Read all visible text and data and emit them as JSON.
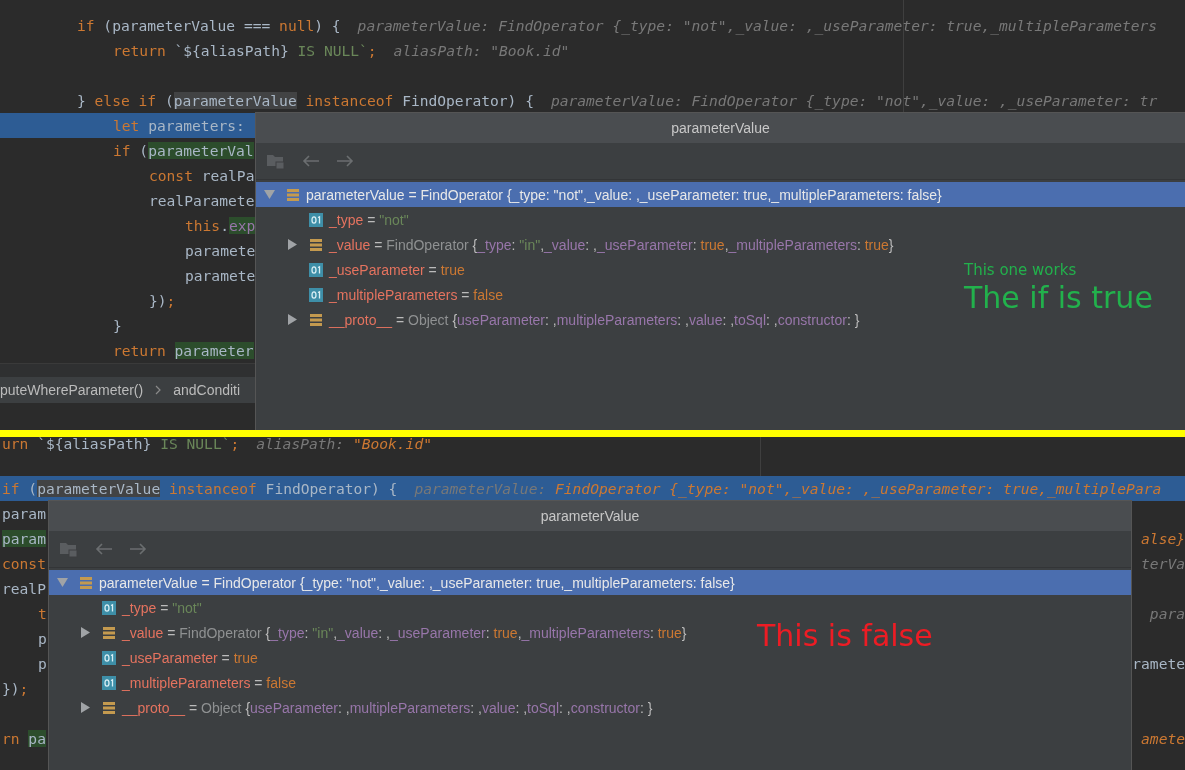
{
  "panels": [
    {
      "editor": {
        "lines": [
          {
            "kind": "code",
            "selected": false,
            "code": [
              {
                "text": "if",
                "kind": "kw"
              },
              {
                "text": " (parameterValue === ",
                "kind": "id"
              },
              {
                "text": "null",
                "kind": "kw"
              },
              {
                "text": ") {",
                "kind": "id"
              }
            ],
            "hint": [
              {
                "text": "parameterValue: FindOperator {_type: \"not\",_value: ,_useParameter: true,_multipleParameters",
                "kind": "hint"
              }
            ],
            "children": [
              {
                "kind": "code",
                "selected": false,
                "code": [
                  {
                    "text": "return",
                    "kind": "kw"
                  },
                  {
                    "text": " `${aliasPath}",
                    "kind": "id"
                  },
                  {
                    "text": " IS NULL`",
                    "kind": "str"
                  },
                  {
                    "text": ";",
                    "kind": "kw"
                  }
                ],
                "hint": [
                  {
                    "text": "aliasPath: \"Book.id\"",
                    "kind": "hint"
                  }
                ]
              },
              {
                "kind": "blank",
                "selected": false
              }
            ]
          },
          {
            "kind": "code",
            "selected": false,
            "code": [
              {
                "text": "} ",
                "kind": "id"
              },
              {
                "text": "else if ",
                "kind": "kw"
              },
              {
                "text": "(",
                "kind": "id"
              },
              {
                "text": "parameterValue",
                "kind": "id",
                "read_highlight": true
              },
              {
                "text": " instanceof",
                "kind": "kw"
              },
              {
                "text": " FindOperator) {",
                "kind": "id"
              }
            ],
            "hint": [
              {
                "text": "parameterValue: FindOperator {_type: \"not\",_value: ,_useParameter: tr",
                "kind": "hint"
              }
            ],
            "children": [
              {
                "kind": "code",
                "selected": true,
                "code": [
                  {
                    "text": "let",
                    "kind": "kw"
                  },
                  {
                    "text": " parameters:",
                    "kind": "id"
                  }
                ]
              },
              {
                "kind": "code",
                "selected": false,
                "code": [
                  {
                    "text": "if",
                    "kind": "kw"
                  },
                  {
                    "text": " (",
                    "kind": "id"
                  },
                  {
                    "text": "parameterVal",
                    "kind": "id",
                    "write_highlight": true
                  }
                ],
                "children": [
                  {
                    "kind": "code",
                    "selected": false,
                    "code": [
                      {
                        "text": "const",
                        "kind": "kw"
                      },
                      {
                        "text": " realPa",
                        "kind": "id"
                      }
                    ]
                  },
                  {
                    "kind": "code",
                    "selected": false,
                    "code": [
                      {
                        "text": "realParamete",
                        "kind": "id"
                      }
                    ],
                    "children": [
                      {
                        "kind": "code",
                        "selected": false,
                        "code": [
                          {
                            "text": "this",
                            "kind": "kw"
                          },
                          {
                            "text": ".",
                            "kind": "id"
                          },
                          {
                            "text": "exp",
                            "kind": "prop",
                            "write_highlight": true
                          }
                        ]
                      },
                      {
                        "kind": "code",
                        "selected": false,
                        "code": [
                          {
                            "text": "paramete",
                            "kind": "id"
                          }
                        ]
                      },
                      {
                        "kind": "code",
                        "selected": false,
                        "code": [
                          {
                            "text": "paramete",
                            "kind": "id"
                          }
                        ]
                      }
                    ]
                  },
                  {
                    "kind": "code",
                    "selected": false,
                    "code": [
                      {
                        "text": "})",
                        "kind": "id"
                      },
                      {
                        "text": ";",
                        "kind": "kw"
                      }
                    ]
                  }
                ]
              },
              {
                "kind": "code",
                "selected": false,
                "code": [
                  {
                    "text": "}",
                    "kind": "id"
                  }
                ]
              },
              {
                "kind": "code",
                "selected": false,
                "code": [
                  {
                    "text": "return ",
                    "kind": "kw"
                  },
                  {
                    "text": "parameter",
                    "kind": "id",
                    "write_highlight": true
                  }
                ]
              }
            ]
          }
        ]
      },
      "breadcrumbs": [
        {
          "text": "puteWhereParameter()"
        },
        {
          "text": "andConditi"
        }
      ],
      "popup": {
        "title": "parameterValue",
        "tree": [
          {
            "name": "parameterValue",
            "operator": "=",
            "kind": "object",
            "expanded": true,
            "selected": true,
            "value": [
              {
                "text": "FindOperator {_type: \"not\",_value: ,_useParameter: true,_multipleParameters: false}",
                "kind": "plain"
              }
            ],
            "children": [
              {
                "name": "_type",
                "operator": "=",
                "kind": "primitive",
                "selected": false,
                "value": [
                  {
                    "text": "\"not\"",
                    "kind": "string"
                  }
                ]
              },
              {
                "name": "_value",
                "operator": "=",
                "kind": "object",
                "expanded": false,
                "selected": false,
                "value": [
                  {
                    "text": "FindOperator ",
                    "kind": "type"
                  },
                  {
                    "text": "{",
                    "kind": "plain"
                  },
                  {
                    "text": "_type",
                    "kind": "prop"
                  },
                  {
                    "text": ": ",
                    "kind": "plain"
                  },
                  {
                    "text": "\"in\"",
                    "kind": "string"
                  },
                  {
                    "text": ",",
                    "kind": "plain"
                  },
                  {
                    "text": "_value",
                    "kind": "prop"
                  },
                  {
                    "text": ": ,",
                    "kind": "plain"
                  },
                  {
                    "text": "_useParameter",
                    "kind": "prop"
                  },
                  {
                    "text": ": ",
                    "kind": "plain"
                  },
                  {
                    "text": "true",
                    "kind": "keyword"
                  },
                  {
                    "text": ",",
                    "kind": "plain"
                  },
                  {
                    "text": "_multipleParameters",
                    "kind": "prop"
                  },
                  {
                    "text": ": ",
                    "kind": "plain"
                  },
                  {
                    "text": "true",
                    "kind": "keyword"
                  },
                  {
                    "text": "}",
                    "kind": "plain"
                  }
                ]
              },
              {
                "name": "_useParameter",
                "operator": "=",
                "kind": "primitive",
                "selected": false,
                "value": [
                  {
                    "text": "true",
                    "kind": "keyword"
                  }
                ]
              },
              {
                "name": "_multipleParameters",
                "operator": "=",
                "kind": "primitive",
                "selected": false,
                "value": [
                  {
                    "text": "false",
                    "kind": "keyword"
                  }
                ]
              },
              {
                "name": "__proto__",
                "operator": "=",
                "kind": "object",
                "expanded": false,
                "selected": false,
                "value": [
                  {
                    "text": "Object ",
                    "kind": "type"
                  },
                  {
                    "text": "{",
                    "kind": "plain"
                  },
                  {
                    "text": "useParameter",
                    "kind": "prop"
                  },
                  {
                    "text": ": ,",
                    "kind": "plain"
                  },
                  {
                    "text": "multipleParameters",
                    "kind": "prop"
                  },
                  {
                    "text": ": ,",
                    "kind": "plain"
                  },
                  {
                    "text": "value",
                    "kind": "prop"
                  },
                  {
                    "text": ": ,",
                    "kind": "plain"
                  },
                  {
                    "text": "toSql",
                    "kind": "prop"
                  },
                  {
                    "text": ": ,",
                    "kind": "plain"
                  },
                  {
                    "text": "constructor",
                    "kind": "prop"
                  },
                  {
                    "text": ": }",
                    "kind": "plain"
                  }
                ]
              }
            ]
          }
        ],
        "annotations": [
          {
            "text": "This one works",
            "kind": "caption",
            "color": "#22b14c"
          },
          {
            "text": "The if is true",
            "kind": "headline",
            "color": "#22b14c"
          }
        ]
      }
    },
    {
      "editor": {
        "lines": [
          {
            "kind": "code",
            "selected": false,
            "code": [
              {
                "text": "urn",
                "kind": "kw"
              },
              {
                "text": " `${aliasPath}",
                "kind": "id"
              },
              {
                "text": " IS NULL`",
                "kind": "str"
              },
              {
                "text": ";",
                "kind": "kw"
              }
            ],
            "hint": [
              {
                "text": "aliasPath: ",
                "kind": "hint"
              },
              {
                "text": "\"Book.id\"",
                "kind": "hintval"
              }
            ]
          },
          {
            "kind": "blank",
            "selected": false
          },
          {
            "kind": "code",
            "selected": true,
            "code": [
              {
                "text": "if",
                "kind": "kw"
              },
              {
                "text": " (",
                "kind": "id"
              },
              {
                "text": "parameterValue",
                "kind": "id",
                "read_highlight": true
              },
              {
                "text": " instanceof",
                "kind": "kw"
              },
              {
                "text": " FindOperator) {",
                "kind": "id"
              }
            ],
            "hint": [
              {
                "text": "parameterValue: ",
                "kind": "hint"
              },
              {
                "text": "FindOperator {_type: \"not\",_value: ,_useParameter: true,_multiplePara",
                "kind": "hintval"
              }
            ]
          },
          {
            "kind": "code",
            "selected": false,
            "code": [
              {
                "text": "param",
                "kind": "id"
              }
            ]
          },
          {
            "kind": "code",
            "selected": false,
            "code": [
              {
                "text": "param",
                "kind": "id",
                "write_highlight": true
              }
            ],
            "right": [
              {
                "text": "alse}",
                "kind": "hintval"
              }
            ]
          },
          {
            "kind": "code",
            "selected": false,
            "code": [
              {
                "text": "const",
                "kind": "kw"
              }
            ],
            "right": [
              {
                "text": "terVa",
                "kind": "hint"
              }
            ]
          },
          {
            "kind": "code",
            "selected": false,
            "code": [
              {
                "text": "realP",
                "kind": "id"
              }
            ],
            "children": [
              {
                "kind": "code",
                "selected": false,
                "code": [
                  {
                    "text": "t",
                    "kind": "kw"
                  }
                ],
                "right": [
                  {
                    "text": "para",
                    "kind": "hint"
                  }
                ]
              },
              {
                "kind": "code",
                "selected": false,
                "code": [
                  {
                    "text": "p",
                    "kind": "id"
                  }
                ]
              },
              {
                "kind": "code",
                "selected": false,
                "code": [
                  {
                    "text": "p",
                    "kind": "id"
                  }
                ],
                "right": [
                  {
                    "text": "ramete",
                    "kind": "id"
                  }
                ]
              }
            ]
          },
          {
            "kind": "code",
            "selected": false,
            "code": [
              {
                "text": "})",
                "kind": "id"
              },
              {
                "text": ";",
                "kind": "kw"
              }
            ]
          },
          {
            "kind": "blank",
            "selected": false
          },
          {
            "kind": "code",
            "selected": false,
            "code": [
              {
                "text": "rn ",
                "kind": "kw"
              },
              {
                "text": "pa",
                "kind": "id",
                "write_highlight": true
              }
            ],
            "right": [
              {
                "text": "amete",
                "kind": "hintval"
              }
            ]
          }
        ]
      },
      "popup": {
        "title": "parameterValue",
        "tree": [
          {
            "name": "parameterValue",
            "operator": "=",
            "kind": "object",
            "expanded": true,
            "selected": true,
            "value": [
              {
                "text": "FindOperator {_type: \"not\",_value: ,_useParameter: true,_multipleParameters: false}",
                "kind": "plain"
              }
            ],
            "children": [
              {
                "name": "_type",
                "operator": "=",
                "kind": "primitive",
                "selected": false,
                "value": [
                  {
                    "text": "\"not\"",
                    "kind": "string"
                  }
                ]
              },
              {
                "name": "_value",
                "operator": "=",
                "kind": "object",
                "expanded": false,
                "selected": false,
                "value": [
                  {
                    "text": "FindOperator ",
                    "kind": "type"
                  },
                  {
                    "text": "{",
                    "kind": "plain"
                  },
                  {
                    "text": "_type",
                    "kind": "prop"
                  },
                  {
                    "text": ": ",
                    "kind": "plain"
                  },
                  {
                    "text": "\"in\"",
                    "kind": "string"
                  },
                  {
                    "text": ",",
                    "kind": "plain"
                  },
                  {
                    "text": "_value",
                    "kind": "prop"
                  },
                  {
                    "text": ": ,",
                    "kind": "plain"
                  },
                  {
                    "text": "_useParameter",
                    "kind": "prop"
                  },
                  {
                    "text": ": ",
                    "kind": "plain"
                  },
                  {
                    "text": "true",
                    "kind": "keyword"
                  },
                  {
                    "text": ",",
                    "kind": "plain"
                  },
                  {
                    "text": "_multipleParameters",
                    "kind": "prop"
                  },
                  {
                    "text": ": ",
                    "kind": "plain"
                  },
                  {
                    "text": "true",
                    "kind": "keyword"
                  },
                  {
                    "text": "}",
                    "kind": "plain"
                  }
                ]
              },
              {
                "name": "_useParameter",
                "operator": "=",
                "kind": "primitive",
                "selected": false,
                "value": [
                  {
                    "text": "true",
                    "kind": "keyword"
                  }
                ]
              },
              {
                "name": "_multipleParameters",
                "operator": "=",
                "kind": "primitive",
                "selected": false,
                "value": [
                  {
                    "text": "false",
                    "kind": "keyword"
                  }
                ]
              },
              {
                "name": "__proto__",
                "operator": "=",
                "kind": "object",
                "expanded": false,
                "selected": false,
                "value": [
                  {
                    "text": "Object ",
                    "kind": "type"
                  },
                  {
                    "text": "{",
                    "kind": "plain"
                  },
                  {
                    "text": "useParameter",
                    "kind": "prop"
                  },
                  {
                    "text": ": ,",
                    "kind": "plain"
                  },
                  {
                    "text": "multipleParameters",
                    "kind": "prop"
                  },
                  {
                    "text": ": ,",
                    "kind": "plain"
                  },
                  {
                    "text": "value",
                    "kind": "prop"
                  },
                  {
                    "text": ": ,",
                    "kind": "plain"
                  },
                  {
                    "text": "toSql",
                    "kind": "prop"
                  },
                  {
                    "text": ": ,",
                    "kind": "plain"
                  },
                  {
                    "text": "constructor",
                    "kind": "prop"
                  },
                  {
                    "text": ": }",
                    "kind": "plain"
                  }
                ]
              }
            ]
          }
        ],
        "annotations": [
          {
            "text": "This is false",
            "kind": "headline",
            "color": "#ed1c24"
          }
        ]
      }
    }
  ]
}
